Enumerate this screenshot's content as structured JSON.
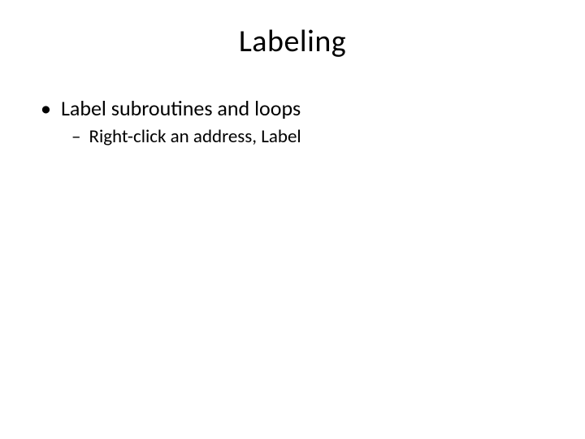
{
  "slide": {
    "title": "Labeling",
    "bullets": [
      {
        "marker": "•",
        "text": "Label subroutines and loops",
        "subbullets": [
          {
            "marker": "–",
            "text": "Right-click an address, Label"
          }
        ]
      }
    ]
  }
}
